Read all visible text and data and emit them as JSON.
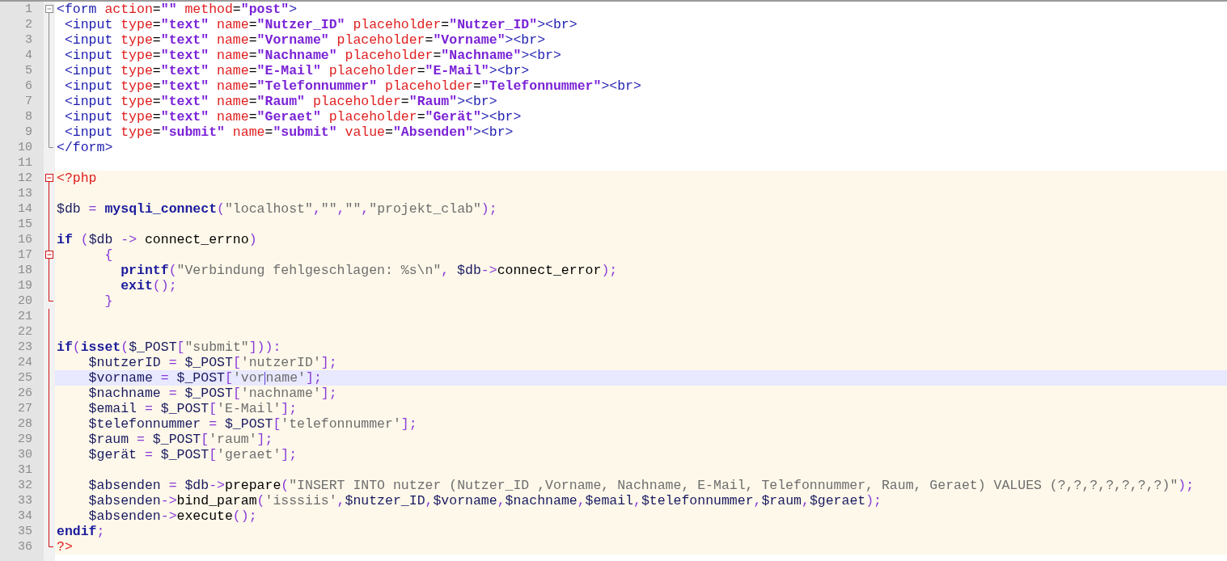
{
  "editor": {
    "lines": [
      {
        "number": "1",
        "kind": "start",
        "embedded": false,
        "selected": false,
        "tokens": [
          {
            "kind": "tag",
            "text": "<form"
          },
          {
            "kind": "attr",
            "text": " action"
          },
          {
            "kind": "plain",
            "text": "="
          },
          {
            "kind": "val",
            "text": "\"\""
          },
          {
            "kind": "attr",
            "text": " method"
          },
          {
            "kind": "plain",
            "text": "="
          },
          {
            "kind": "val",
            "text": "\"post\""
          },
          {
            "kind": "tag",
            "text": ">"
          }
        ]
      },
      {
        "number": "2",
        "kind": "code",
        "embedded": false,
        "selected": false,
        "tokens": [
          {
            "kind": "tag",
            "text": " <input"
          },
          {
            "kind": "attr",
            "text": " type"
          },
          {
            "kind": "plain",
            "text": "="
          },
          {
            "kind": "val",
            "text": "\"text\""
          },
          {
            "kind": "attr",
            "text": " name"
          },
          {
            "kind": "plain",
            "text": "="
          },
          {
            "kind": "val",
            "text": "\"Nutzer_ID\""
          },
          {
            "kind": "attr",
            "text": " placeholder"
          },
          {
            "kind": "plain",
            "text": "="
          },
          {
            "kind": "val",
            "text": "\"Nutzer_ID\""
          },
          {
            "kind": "tag",
            "text": "><br>"
          }
        ]
      },
      {
        "number": "3",
        "kind": "code",
        "embedded": false,
        "selected": false,
        "tokens": [
          {
            "kind": "tag",
            "text": " <input"
          },
          {
            "kind": "attr",
            "text": " type"
          },
          {
            "kind": "plain",
            "text": "="
          },
          {
            "kind": "val",
            "text": "\"text\""
          },
          {
            "kind": "attr",
            "text": " name"
          },
          {
            "kind": "plain",
            "text": "="
          },
          {
            "kind": "val",
            "text": "\"Vorname\""
          },
          {
            "kind": "attr",
            "text": " placeholder"
          },
          {
            "kind": "plain",
            "text": "="
          },
          {
            "kind": "val",
            "text": "\"Vorname\""
          },
          {
            "kind": "tag",
            "text": "><br>"
          }
        ]
      },
      {
        "number": "4",
        "kind": "code",
        "embedded": false,
        "selected": false,
        "tokens": [
          {
            "kind": "tag",
            "text": " <input"
          },
          {
            "kind": "attr",
            "text": " type"
          },
          {
            "kind": "plain",
            "text": "="
          },
          {
            "kind": "val",
            "text": "\"text\""
          },
          {
            "kind": "attr",
            "text": " name"
          },
          {
            "kind": "plain",
            "text": "="
          },
          {
            "kind": "val",
            "text": "\"Nachname\""
          },
          {
            "kind": "attr",
            "text": " placeholder"
          },
          {
            "kind": "plain",
            "text": "="
          },
          {
            "kind": "val",
            "text": "\"Nachname\""
          },
          {
            "kind": "tag",
            "text": "><br>"
          }
        ]
      },
      {
        "number": "5",
        "kind": "code",
        "embedded": false,
        "selected": false,
        "tokens": [
          {
            "kind": "tag",
            "text": " <input"
          },
          {
            "kind": "attr",
            "text": " type"
          },
          {
            "kind": "plain",
            "text": "="
          },
          {
            "kind": "val",
            "text": "\"text\""
          },
          {
            "kind": "attr",
            "text": " name"
          },
          {
            "kind": "plain",
            "text": "="
          },
          {
            "kind": "val",
            "text": "\"E-Mail\""
          },
          {
            "kind": "attr",
            "text": " placeholder"
          },
          {
            "kind": "plain",
            "text": "="
          },
          {
            "kind": "val",
            "text": "\"E-Mail\""
          },
          {
            "kind": "tag",
            "text": "><br>"
          }
        ]
      },
      {
        "number": "6",
        "kind": "code",
        "embedded": false,
        "selected": false,
        "tokens": [
          {
            "kind": "tag",
            "text": " <input"
          },
          {
            "kind": "attr",
            "text": " type"
          },
          {
            "kind": "plain",
            "text": "="
          },
          {
            "kind": "val",
            "text": "\"text\""
          },
          {
            "kind": "attr",
            "text": " name"
          },
          {
            "kind": "plain",
            "text": "="
          },
          {
            "kind": "val",
            "text": "\"Telefonnummer\""
          },
          {
            "kind": "attr",
            "text": " placeholder"
          },
          {
            "kind": "plain",
            "text": "="
          },
          {
            "kind": "val",
            "text": "\"Telefonnummer\""
          },
          {
            "kind": "tag",
            "text": "><br>"
          }
        ]
      },
      {
        "number": "7",
        "kind": "code",
        "embedded": false,
        "selected": false,
        "tokens": [
          {
            "kind": "tag",
            "text": " <input"
          },
          {
            "kind": "attr",
            "text": " type"
          },
          {
            "kind": "plain",
            "text": "="
          },
          {
            "kind": "val",
            "text": "\"text\""
          },
          {
            "kind": "attr",
            "text": " name"
          },
          {
            "kind": "plain",
            "text": "="
          },
          {
            "kind": "val",
            "text": "\"Raum\""
          },
          {
            "kind": "attr",
            "text": " placeholder"
          },
          {
            "kind": "plain",
            "text": "="
          },
          {
            "kind": "val",
            "text": "\"Raum\""
          },
          {
            "kind": "tag",
            "text": "><br>"
          }
        ]
      },
      {
        "number": "8",
        "kind": "code",
        "embedded": false,
        "selected": false,
        "tokens": [
          {
            "kind": "tag",
            "text": " <input"
          },
          {
            "kind": "attr",
            "text": " type"
          },
          {
            "kind": "plain",
            "text": "="
          },
          {
            "kind": "val",
            "text": "\"text\""
          },
          {
            "kind": "attr",
            "text": " name"
          },
          {
            "kind": "plain",
            "text": "="
          },
          {
            "kind": "val",
            "text": "\"Geraet\""
          },
          {
            "kind": "attr",
            "text": " placeholder"
          },
          {
            "kind": "plain",
            "text": "="
          },
          {
            "kind": "val",
            "text": "\"Gerät\""
          },
          {
            "kind": "tag",
            "text": "><br>"
          }
        ]
      },
      {
        "number": "9",
        "kind": "code",
        "embedded": false,
        "selected": false,
        "tokens": [
          {
            "kind": "tag",
            "text": " <input"
          },
          {
            "kind": "attr",
            "text": " type"
          },
          {
            "kind": "plain",
            "text": "="
          },
          {
            "kind": "val",
            "text": "\"submit\""
          },
          {
            "kind": "attr",
            "text": " name"
          },
          {
            "kind": "plain",
            "text": "="
          },
          {
            "kind": "val",
            "text": "\"submit\""
          },
          {
            "kind": "attr",
            "text": " value"
          },
          {
            "kind": "plain",
            "text": "="
          },
          {
            "kind": "val",
            "text": "\"Absenden\""
          },
          {
            "kind": "tag",
            "text": "><br>"
          }
        ]
      },
      {
        "number": "10",
        "kind": "end",
        "embedded": false,
        "selected": false,
        "tokens": [
          {
            "kind": "tag",
            "text": "</form>"
          }
        ]
      },
      {
        "number": "11",
        "kind": "code",
        "embedded": false,
        "selected": false
      },
      {
        "number": "12",
        "kind": "start",
        "embedded": true,
        "selected": false,
        "tokens": [
          {
            "kind": "php",
            "text": "<?php"
          }
        ]
      },
      {
        "number": "13",
        "kind": "code",
        "embedded": true,
        "selected": false
      },
      {
        "number": "14",
        "kind": "code",
        "embedded": true,
        "selected": false,
        "tokens": [
          {
            "kind": "var",
            "text": "$db"
          },
          {
            "kind": "op",
            "text": " = "
          },
          {
            "kind": "kw",
            "text": "mysqli_connect"
          },
          {
            "kind": "op",
            "text": "("
          },
          {
            "kind": "str",
            "text": "\"localhost\""
          },
          {
            "kind": "op",
            "text": ","
          },
          {
            "kind": "str",
            "text": "\"\""
          },
          {
            "kind": "op",
            "text": ","
          },
          {
            "kind": "str",
            "text": "\"\""
          },
          {
            "kind": "op",
            "text": ","
          },
          {
            "kind": "str",
            "text": "\"projekt_clab\""
          },
          {
            "kind": "op",
            "text": ");"
          }
        ]
      },
      {
        "number": "15",
        "kind": "code",
        "embedded": true,
        "selected": false
      },
      {
        "number": "16",
        "kind": "code",
        "embedded": true,
        "selected": false,
        "tokens": [
          {
            "kind": "kw",
            "text": "if"
          },
          {
            "kind": "op",
            "text": " ("
          },
          {
            "kind": "var",
            "text": "$db"
          },
          {
            "kind": "op",
            "text": " -> "
          },
          {
            "kind": "plain",
            "text": "connect_errno"
          },
          {
            "kind": "op",
            "text": ")"
          }
        ]
      },
      {
        "number": "17",
        "kind": "start",
        "embedded": true,
        "selected": false,
        "tokens": [
          {
            "kind": "op",
            "text": "      {"
          }
        ]
      },
      {
        "number": "18",
        "kind": "code",
        "embedded": true,
        "selected": false,
        "tokens": [
          {
            "kind": "kw",
            "text": "        printf"
          },
          {
            "kind": "op",
            "text": "("
          },
          {
            "kind": "str",
            "text": "\"Verbindung fehlgeschlagen: %s\\n\""
          },
          {
            "kind": "op",
            "text": ", "
          },
          {
            "kind": "var",
            "text": "$db"
          },
          {
            "kind": "op",
            "text": "->"
          },
          {
            "kind": "plain",
            "text": "connect_error"
          },
          {
            "kind": "op",
            "text": ");"
          }
        ]
      },
      {
        "number": "19",
        "kind": "code",
        "embedded": true,
        "selected": false,
        "tokens": [
          {
            "kind": "kw",
            "text": "        exit"
          },
          {
            "kind": "op",
            "text": "();"
          }
        ]
      },
      {
        "number": "20",
        "kind": "end",
        "embedded": true,
        "selected": false,
        "tokens": [
          {
            "kind": "op",
            "text": "      }"
          }
        ]
      },
      {
        "number": "21",
        "kind": "code",
        "embedded": true,
        "selected": false
      },
      {
        "number": "22",
        "kind": "code",
        "embedded": true,
        "selected": false
      },
      {
        "number": "23",
        "kind": "code",
        "embedded": true,
        "selected": false,
        "tokens": [
          {
            "kind": "kw",
            "text": "if"
          },
          {
            "kind": "op",
            "text": "("
          },
          {
            "kind": "kw",
            "text": "isset"
          },
          {
            "kind": "op",
            "text": "("
          },
          {
            "kind": "var",
            "text": "$_POST"
          },
          {
            "kind": "op",
            "text": "["
          },
          {
            "kind": "str",
            "text": "\"submit\""
          },
          {
            "kind": "op",
            "text": "])):"
          }
        ]
      },
      {
        "number": "24",
        "kind": "code",
        "embedded": true,
        "selected": false,
        "tokens": [
          {
            "kind": "var",
            "text": "    $nutzerID"
          },
          {
            "kind": "op",
            "text": " = "
          },
          {
            "kind": "var",
            "text": "$_POST"
          },
          {
            "kind": "op",
            "text": "["
          },
          {
            "kind": "str",
            "text": "'nutzerID'"
          },
          {
            "kind": "op",
            "text": "];"
          }
        ]
      },
      {
        "number": "25",
        "kind": "code",
        "embedded": true,
        "selected": true,
        "tokens": [
          {
            "kind": "var",
            "text": "    $vorname"
          },
          {
            "kind": "op",
            "text": " = "
          },
          {
            "kind": "var",
            "text": "$_POST"
          },
          {
            "kind": "op",
            "text": "["
          },
          {
            "kind": "str",
            "text": "'vor"
          },
          {
            "kind": "caret"
          },
          {
            "kind": "str",
            "text": "name'"
          },
          {
            "kind": "op",
            "text": "];"
          }
        ]
      },
      {
        "number": "26",
        "kind": "code",
        "embedded": true,
        "selected": false,
        "tokens": [
          {
            "kind": "var",
            "text": "    $nachname"
          },
          {
            "kind": "op",
            "text": " = "
          },
          {
            "kind": "var",
            "text": "$_POST"
          },
          {
            "kind": "op",
            "text": "["
          },
          {
            "kind": "str",
            "text": "'nachname'"
          },
          {
            "kind": "op",
            "text": "];"
          }
        ]
      },
      {
        "number": "27",
        "kind": "code",
        "embedded": true,
        "selected": false,
        "tokens": [
          {
            "kind": "var",
            "text": "    $email"
          },
          {
            "kind": "op",
            "text": " = "
          },
          {
            "kind": "var",
            "text": "$_POST"
          },
          {
            "kind": "op",
            "text": "["
          },
          {
            "kind": "str",
            "text": "'E-Mail'"
          },
          {
            "kind": "op",
            "text": "];"
          }
        ]
      },
      {
        "number": "28",
        "kind": "code",
        "embedded": true,
        "selected": false,
        "tokens": [
          {
            "kind": "var",
            "text": "    $telefonnummer"
          },
          {
            "kind": "op",
            "text": " = "
          },
          {
            "kind": "var",
            "text": "$_POST"
          },
          {
            "kind": "op",
            "text": "["
          },
          {
            "kind": "str",
            "text": "'telefonnummer'"
          },
          {
            "kind": "op",
            "text": "];"
          }
        ]
      },
      {
        "number": "29",
        "kind": "code",
        "embedded": true,
        "selected": false,
        "tokens": [
          {
            "kind": "var",
            "text": "    $raum"
          },
          {
            "kind": "op",
            "text": " = "
          },
          {
            "kind": "var",
            "text": "$_POST"
          },
          {
            "kind": "op",
            "text": "["
          },
          {
            "kind": "str",
            "text": "'raum'"
          },
          {
            "kind": "op",
            "text": "];"
          }
        ]
      },
      {
        "number": "30",
        "kind": "code",
        "embedded": true,
        "selected": false,
        "tokens": [
          {
            "kind": "var",
            "text": "    $gerät"
          },
          {
            "kind": "op",
            "text": " = "
          },
          {
            "kind": "var",
            "text": "$_POST"
          },
          {
            "kind": "op",
            "text": "["
          },
          {
            "kind": "str",
            "text": "'geraet'"
          },
          {
            "kind": "op",
            "text": "];"
          }
        ]
      },
      {
        "number": "31",
        "kind": "code",
        "embedded": true,
        "selected": false
      },
      {
        "number": "32",
        "kind": "code",
        "embedded": true,
        "selected": false,
        "tokens": [
          {
            "kind": "var",
            "text": "    $absenden"
          },
          {
            "kind": "op",
            "text": " = "
          },
          {
            "kind": "var",
            "text": "$db"
          },
          {
            "kind": "op",
            "text": "->"
          },
          {
            "kind": "plain",
            "text": "prepare"
          },
          {
            "kind": "op",
            "text": "("
          },
          {
            "kind": "str",
            "text": "\"INSERT INTO nutzer (Nutzer_ID ,Vorname, Nachname, E-Mail, Telefonnummer, Raum, Geraet) VALUES (?,?,?,?,?,?,?)\""
          },
          {
            "kind": "op",
            "text": ");"
          }
        ]
      },
      {
        "number": "33",
        "kind": "code",
        "embedded": true,
        "selected": false,
        "tokens": [
          {
            "kind": "var",
            "text": "    $absenden"
          },
          {
            "kind": "op",
            "text": "->"
          },
          {
            "kind": "plain",
            "text": "bind_param"
          },
          {
            "kind": "op",
            "text": "("
          },
          {
            "kind": "str",
            "text": "'isssiis'"
          },
          {
            "kind": "op",
            "text": ","
          },
          {
            "kind": "var",
            "text": "$nutzer_ID"
          },
          {
            "kind": "op",
            "text": ","
          },
          {
            "kind": "var",
            "text": "$vorname"
          },
          {
            "kind": "op",
            "text": ","
          },
          {
            "kind": "var",
            "text": "$nachname"
          },
          {
            "kind": "op",
            "text": ","
          },
          {
            "kind": "var",
            "text": "$email"
          },
          {
            "kind": "op",
            "text": ","
          },
          {
            "kind": "var",
            "text": "$telefonnummer"
          },
          {
            "kind": "op",
            "text": ","
          },
          {
            "kind": "var",
            "text": "$raum"
          },
          {
            "kind": "op",
            "text": ","
          },
          {
            "kind": "var",
            "text": "$geraet"
          },
          {
            "kind": "op",
            "text": ");"
          }
        ]
      },
      {
        "number": "34",
        "kind": "code",
        "embedded": true,
        "selected": false,
        "tokens": [
          {
            "kind": "var",
            "text": "    $absenden"
          },
          {
            "kind": "op",
            "text": "->"
          },
          {
            "kind": "plain",
            "text": "execute"
          },
          {
            "kind": "op",
            "text": "();"
          }
        ]
      },
      {
        "number": "35",
        "kind": "code",
        "embedded": true,
        "selected": false,
        "tokens": [
          {
            "kind": "kw",
            "text": "endif"
          },
          {
            "kind": "op",
            "text": ";"
          }
        ]
      },
      {
        "number": "36",
        "kind": "end",
        "embedded": true,
        "selected": false,
        "tokens": [
          {
            "kind": "php",
            "text": "?>"
          }
        ]
      }
    ]
  }
}
